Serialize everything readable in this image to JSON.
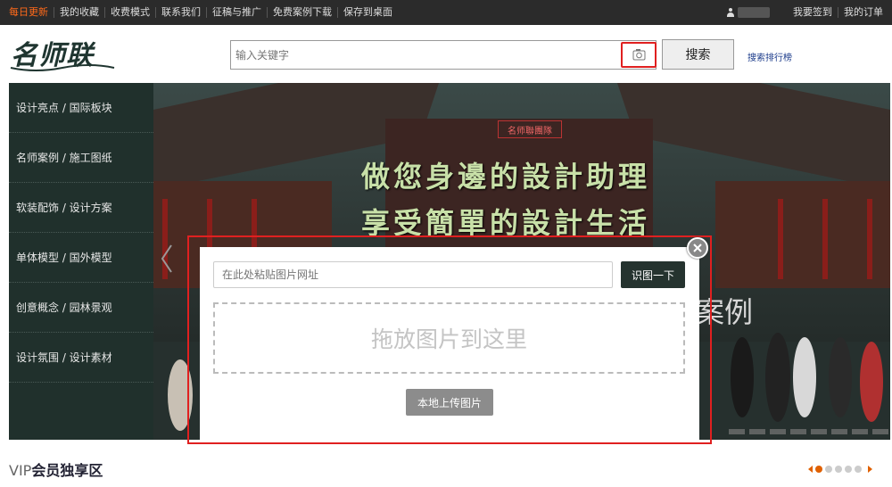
{
  "topbar": {
    "nav": [
      "每日更新",
      "我的收藏",
      "收费模式",
      "联系我们",
      "征稿与推广",
      "免费案例下载",
      "保存到桌面"
    ],
    "right_links": [
      "我要签到",
      "我的订单"
    ]
  },
  "header": {
    "logo_text": "名师联",
    "search_placeholder": "输入关键字",
    "search_button": "搜索",
    "rank_link": "搜索排行榜"
  },
  "banner": {
    "menu": [
      "设计亮点 / 国际板块",
      "名师案例 / 施工图纸",
      "软装配饰 / 设计方案",
      "单体模型 / 国外模型",
      "创意概念 / 园林景观",
      "设计氛围 / 设计素材"
    ],
    "tag": "名师聯團隊",
    "headline_1": "做您身邊的設計助理",
    "headline_2": "享受簡單的設計生活",
    "partial_text": "案例"
  },
  "modal": {
    "url_placeholder": "在此处粘贴图片网址",
    "recognize_button": "识图一下",
    "drop_text": "拖放图片到这里",
    "upload_button": "本地上传图片"
  },
  "vip": {
    "prefix": "VIP",
    "title": "会员独享区"
  },
  "colors": {
    "accent_orange": "#e06000",
    "highlight_red": "#e02020",
    "menu_bg": "#20302c",
    "recognize_btn": "#25332f"
  }
}
